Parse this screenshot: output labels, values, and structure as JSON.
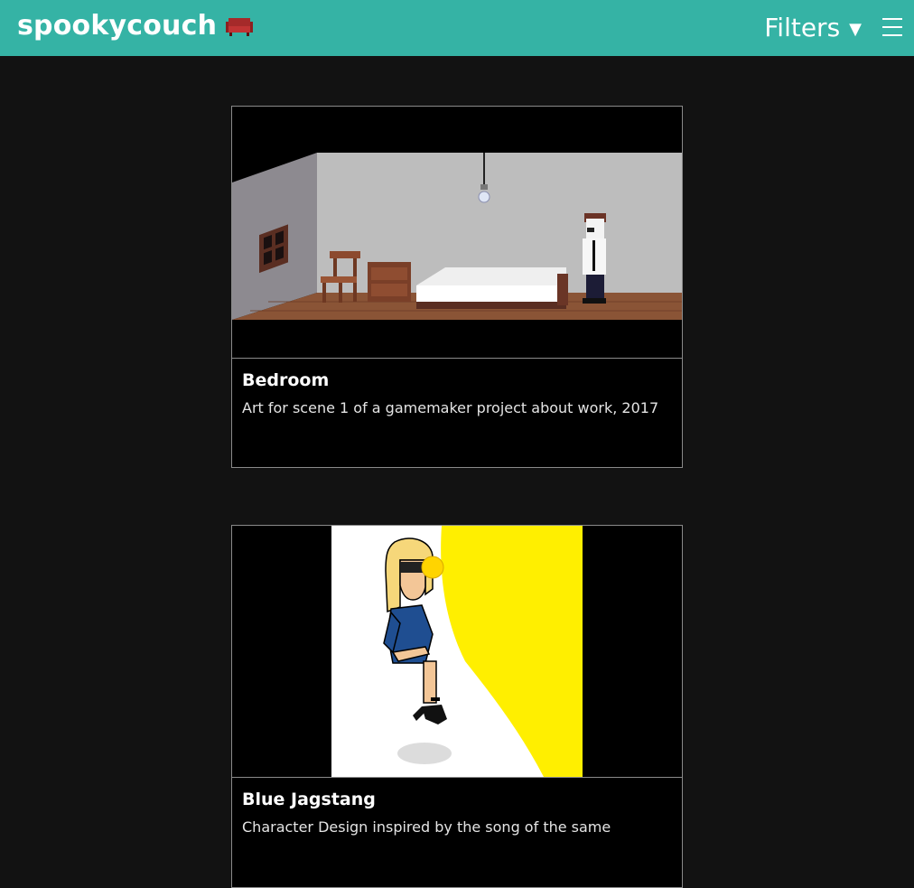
{
  "header": {
    "brand": "spookycouch",
    "filters_label": "Filters",
    "filters_caret": "▼",
    "menu_icon": "hamburger-menu-icon",
    "brand_icon": "couch-icon",
    "background_color": "#35b3a5"
  },
  "gallery": {
    "items": [
      {
        "title": "Bedroom",
        "description": "Art for scene 1 of a gamemaker project about work, 2017",
        "image": "pixel-art-bedroom-scene"
      },
      {
        "title": "Blue Jagstang",
        "description": "Character Design inspired by the song of the same",
        "image": "character-design-woman-in-spotlight"
      }
    ]
  }
}
